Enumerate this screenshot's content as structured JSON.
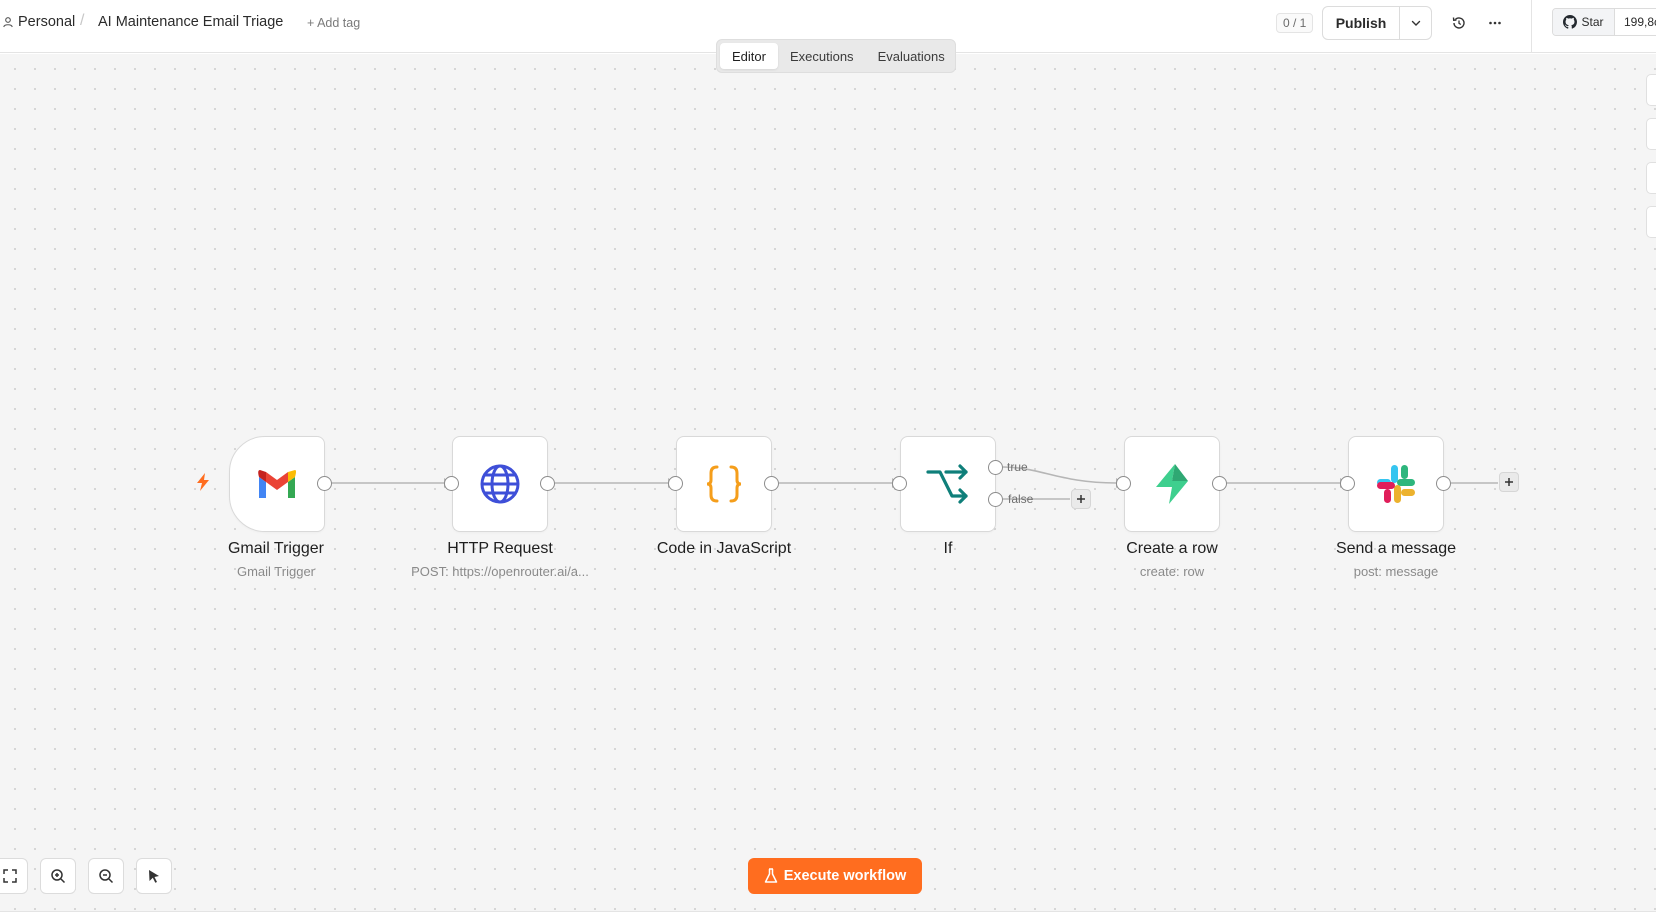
{
  "header": {
    "project": "Personal",
    "separator": "/",
    "workflow_title": "AI Maintenance Email Triage",
    "add_tag": "+ Add tag",
    "counter": "0 / 1",
    "publish_label": "Publish",
    "github_star": "Star",
    "github_count": "199,8с"
  },
  "tabs": [
    {
      "label": "Editor",
      "active": true
    },
    {
      "label": "Executions",
      "active": false
    },
    {
      "label": "Evaluations",
      "active": false
    }
  ],
  "nodes": [
    {
      "name": "Gmail Trigger",
      "subtitle": "Gmail Trigger",
      "icon": "gmail-icon"
    },
    {
      "name": "HTTP Request",
      "subtitle": "POST: https://openrouter.ai/a...",
      "icon": "globe-icon"
    },
    {
      "name": "Code in JavaScript",
      "subtitle": "",
      "icon": "code-braces-icon"
    },
    {
      "name": "If",
      "subtitle": "",
      "icon": "if-branch-icon"
    },
    {
      "name": "Create a row",
      "subtitle": "create: row",
      "icon": "supabase-icon"
    },
    {
      "name": "Send a message",
      "subtitle": "post: message",
      "icon": "slack-icon"
    }
  ],
  "branches": {
    "true": "true",
    "false": "false"
  },
  "execute_label": "Execute workflow",
  "colors": {
    "accent": "#ff6d1f",
    "canvas": "#f5f5f5",
    "if_teal": "#0f7f7a",
    "code_orange": "#f59e1b",
    "http_blue": "#3e4fd8",
    "supabase_green": "#3ecf8e"
  }
}
